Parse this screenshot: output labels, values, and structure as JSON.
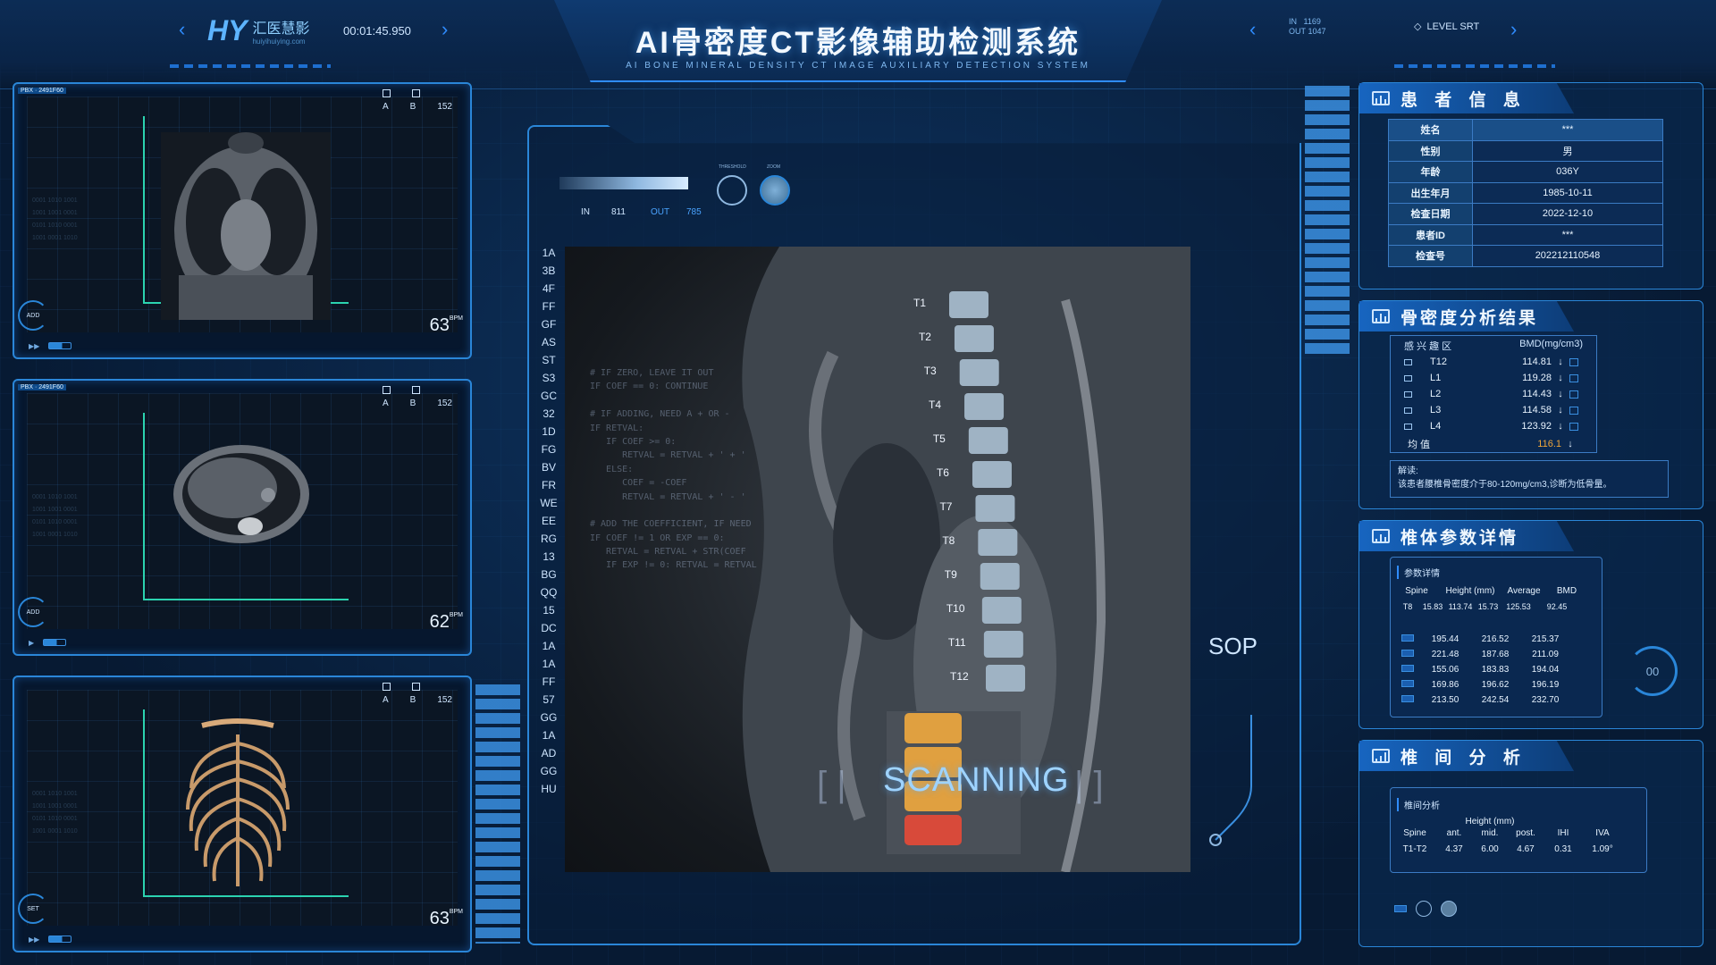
{
  "header": {
    "logo_mark": "HY",
    "logo_cn": "汇医慧影",
    "logo_en": "huiyihuiying.com",
    "time": "00:01:45.950",
    "title": "AI骨密度CT影像辅助检测系统",
    "subtitle": "AI BONE MINERAL DENSITY CT IMAGE AUXILIARY DETECTION SYSTEM",
    "in_label": "IN",
    "in_value": "1169",
    "out_label": "OUT",
    "out_value": "1047",
    "level_label": "LEVEL SRT"
  },
  "viewports": [
    {
      "tag": "PBX · 2491F60",
      "btn_a": "A",
      "btn_b": "B",
      "btn_num": "152",
      "bpm": "63",
      "bpm_unit": "BPM",
      "gauge_label": "ADD",
      "image": "coronal-chest-ct"
    },
    {
      "tag": "PBX · 2491F60",
      "btn_a": "A",
      "btn_b": "B",
      "btn_num": "152",
      "bpm": "62",
      "bpm_unit": "BPM",
      "gauge_label": "ADD",
      "image": "axial-abdomen-ct"
    },
    {
      "tag": "",
      "btn_a": "A",
      "btn_b": "B",
      "btn_num": "152",
      "bpm": "63",
      "bpm_unit": "BPM",
      "gauge_label": "SET",
      "image": "3d-rib-cage"
    }
  ],
  "controls": {
    "in_label": "IN",
    "in_value": "811",
    "out_label": "OUT",
    "out_value": "785",
    "knob1_label": "THRESHOLD",
    "knob2_label": "ZOOM"
  },
  "letter_codes": [
    "1A",
    "3B",
    "4F",
    "FF",
    "GF",
    "AS",
    "ST",
    "S3",
    "GC",
    "32",
    "1D",
    "FG",
    "BV",
    "FR",
    "WE",
    "EE",
    "RG",
    "13",
    "BG",
    "QQ",
    "15",
    "DC",
    "1A",
    "1A",
    "FF",
    "57",
    "GG",
    "1A",
    "AD",
    "GG",
    "HU"
  ],
  "code_lines": [
    "# IF ZERO, LEAVE IT OUT",
    "IF COEF == 0: CONTINUE",
    "",
    "# IF ADDING, NEED A + OR -",
    "IF RETVAL:",
    "   IF COEF >= 0:",
    "      RETVAL = RETVAL + ' + '",
    "   ELSE:",
    "      COEF = -COEF",
    "      RETVAL = RETVAL + ' - '",
    "",
    "# ADD THE COEFFICIENT, IF NEED",
    "IF COEF != 1 OR EXP == 0:",
    "   RETVAL = RETVAL + STR(COEF",
    "   IF EXP != 0: RETVAL = RETVAL"
  ],
  "vertebra_labels": [
    "T1",
    "T2",
    "T3",
    "T4",
    "T5",
    "T6",
    "T7",
    "T8",
    "T9",
    "T10",
    "T11",
    "T12"
  ],
  "scanning_text": "SCANNING",
  "sop_text": "SOP",
  "patient": {
    "title": "患 者 信 息",
    "rows": [
      {
        "k": "姓名",
        "v": "***"
      },
      {
        "k": "性别",
        "v": "男"
      },
      {
        "k": "年龄",
        "v": "036Y"
      },
      {
        "k": "出生年月",
        "v": "1985-10-11"
      },
      {
        "k": "检查日期",
        "v": "2022-12-10"
      },
      {
        "k": "患者ID",
        "v": "***"
      },
      {
        "k": "检查号",
        "v": "202212110548"
      }
    ]
  },
  "bmd": {
    "title": "骨密度分析结果",
    "col1": "感 兴 趣 区",
    "col2": "BMD(mg/cm3)",
    "rows": [
      {
        "name": "T12",
        "value": "114.81",
        "arrow": "↓"
      },
      {
        "name": "L1",
        "value": "119.28",
        "arrow": "↓"
      },
      {
        "name": "L2",
        "value": "114.43",
        "arrow": "↓"
      },
      {
        "name": "L3",
        "value": "114.58",
        "arrow": "↓"
      },
      {
        "name": "L4",
        "value": "123.92",
        "arrow": "↓"
      }
    ],
    "avg_label": "均 值",
    "avg_value": "116.1",
    "avg_arrow": "↓",
    "interp_label": "解读:",
    "interp_text": "该患者腰椎骨密度介于80-120mg/cm3,诊断为低骨量。"
  },
  "vertebral_params": {
    "title": "椎体参数详情",
    "sub_title": "参数详情",
    "headers": [
      "Spine",
      "Height (mm)",
      "Average",
      "BMD"
    ],
    "first_row": {
      "spine": "T8",
      "h1": "15.83",
      "h2": "113.74",
      "h3": "15.73",
      "avg": "125.53",
      "bmd": "92.45"
    },
    "rows": [
      [
        "195.44",
        "216.52",
        "215.37"
      ],
      [
        "221.48",
        "187.68",
        "211.09"
      ],
      [
        "155.06",
        "183.83",
        "194.04"
      ],
      [
        "169.86",
        "196.62",
        "196.19"
      ],
      [
        "213.50",
        "242.54",
        "232.70"
      ]
    ],
    "dial_value": "00"
  },
  "intervertebral": {
    "title": "椎 间 分 析",
    "sub_title": "椎间分析",
    "h_spine": "Spine",
    "h_height": "Height (mm)",
    "h_ant": "ant.",
    "h_mid": "mid.",
    "h_post": "post.",
    "h_ihi": "IHI",
    "h_iva": "IVA",
    "row": {
      "spine": "T1-T2",
      "ant": "4.37",
      "mid": "6.00",
      "post": "4.67",
      "ihi": "0.31",
      "iva": "1.09°"
    }
  },
  "colors": {
    "accent": "#2a86d8",
    "teal": "#2bd3b0",
    "warning": "#f0a63a",
    "danger": "#e0463a"
  }
}
